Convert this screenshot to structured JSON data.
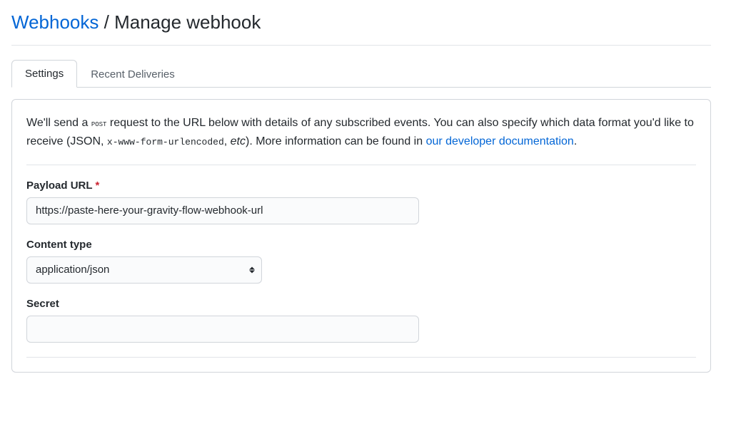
{
  "breadcrumb": {
    "parent": "Webhooks",
    "separator": "/",
    "current": "Manage webhook"
  },
  "tabs": {
    "settings": "Settings",
    "recent": "Recent Deliveries"
  },
  "description": {
    "part1": "We'll send a ",
    "post": "POST",
    "part2": " request to the URL below with details of any subscribed events. You can also specify which data format you'd like to receive (JSON, ",
    "encoded": "x-www-form-urlencoded",
    "part3": ", ",
    "etc": "etc",
    "part4": "). More information can be found in ",
    "link": "our developer documentation",
    "part5": "."
  },
  "form": {
    "payload_url": {
      "label": "Payload URL",
      "required": "*",
      "value": "https://paste-here-your-gravity-flow-webhook-url"
    },
    "content_type": {
      "label": "Content type",
      "selected": "application/json"
    },
    "secret": {
      "label": "Secret",
      "value": ""
    }
  }
}
